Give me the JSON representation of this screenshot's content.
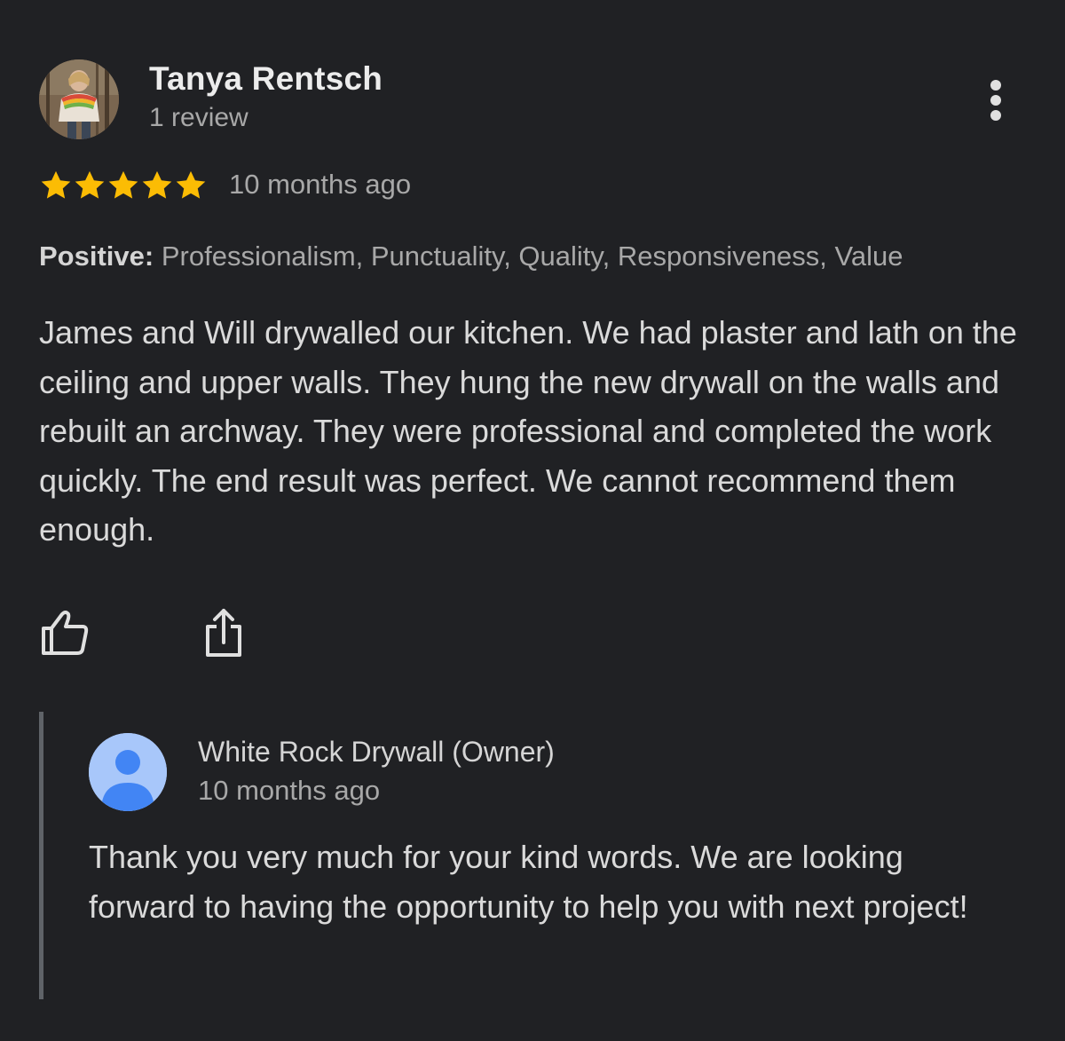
{
  "review": {
    "reviewer_name": "Tanya Rentsch",
    "review_count": "1 review",
    "rating": 5,
    "rating_max": 5,
    "time_ago": "10 months ago",
    "positive_label": "Positive:",
    "positive_items": "Professionalism, Punctuality, Quality, Responsiveness, Value",
    "text": "James and Will drywalled our kitchen. We had plaster and lath on the ceiling and upper walls. They hung the new drywall on the walls and rebuilt an archway. They were professional and completed the work quickly. The end result was perfect. We cannot recommend them enough."
  },
  "owner_reply": {
    "name": "White Rock Drywall (Owner)",
    "time_ago": "10 months ago",
    "text": "Thank you very much for your kind words. We are looking forward to having the opportunity to help you with next project!"
  },
  "icons": {
    "more": "more-vert-icon",
    "like": "thumbs-up-icon",
    "share": "share-icon"
  },
  "colors": {
    "background": "#202124",
    "star": "#fbbc04",
    "owner_avatar_bg": "#a8c7fa",
    "owner_avatar_fg": "#4285f4"
  }
}
